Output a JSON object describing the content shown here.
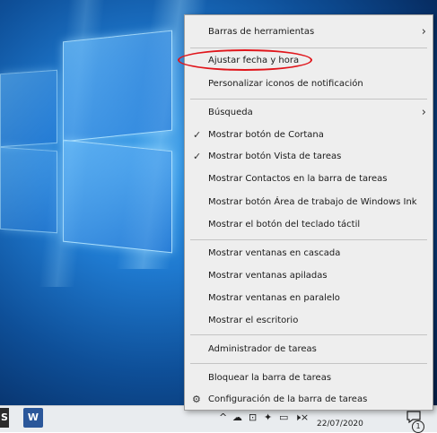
{
  "context_menu": {
    "items": [
      {
        "label": "Barras de herramientas",
        "submenu": true
      },
      {
        "label": "Ajustar fecha y hora",
        "highlighted": true
      },
      {
        "label": "Personalizar iconos de notificación"
      },
      {
        "label": "Búsqueda",
        "submenu": true
      },
      {
        "label": "Mostrar botón de Cortana",
        "checked": true
      },
      {
        "label": "Mostrar botón Vista de tareas",
        "checked": true
      },
      {
        "label": "Mostrar Contactos en la barra de tareas"
      },
      {
        "label": "Mostrar botón Área de trabajo de Windows Ink"
      },
      {
        "label": "Mostrar el botón del teclado táctil"
      },
      {
        "label": "Mostrar ventanas en cascada"
      },
      {
        "label": "Mostrar ventanas apiladas"
      },
      {
        "label": "Mostrar ventanas en paralelo"
      },
      {
        "label": "Mostrar el escritorio"
      },
      {
        "label": "Administrador de tareas"
      },
      {
        "label": "Bloquear la barra de tareas"
      },
      {
        "label": "Configuración de la barra de tareas",
        "icon": "gear-icon"
      }
    ]
  },
  "taskbar": {
    "apps": [
      {
        "icon": "app-icon",
        "label": "S"
      },
      {
        "icon": "word-icon",
        "label": "W"
      }
    ],
    "tray_icons": [
      "chevron-up-icon",
      "cloud-icon",
      "network-icon",
      "dropbox-icon",
      "battery-icon",
      "speaker-muted-icon"
    ],
    "tray_glyph_up": "^",
    "tray_glyph_cloud": "☁",
    "tray_glyph_net": "⊡",
    "tray_glyph_drop": "✦",
    "tray_glyph_batt": "▭",
    "tray_glyph_vol": "🕨×",
    "date": "22/07/2020",
    "notification_count": "1"
  },
  "colors": {
    "highlight_ellipse": "#e0151b",
    "menu_bg": "#eeeeee",
    "taskbar_bg": "#e9ecef"
  }
}
